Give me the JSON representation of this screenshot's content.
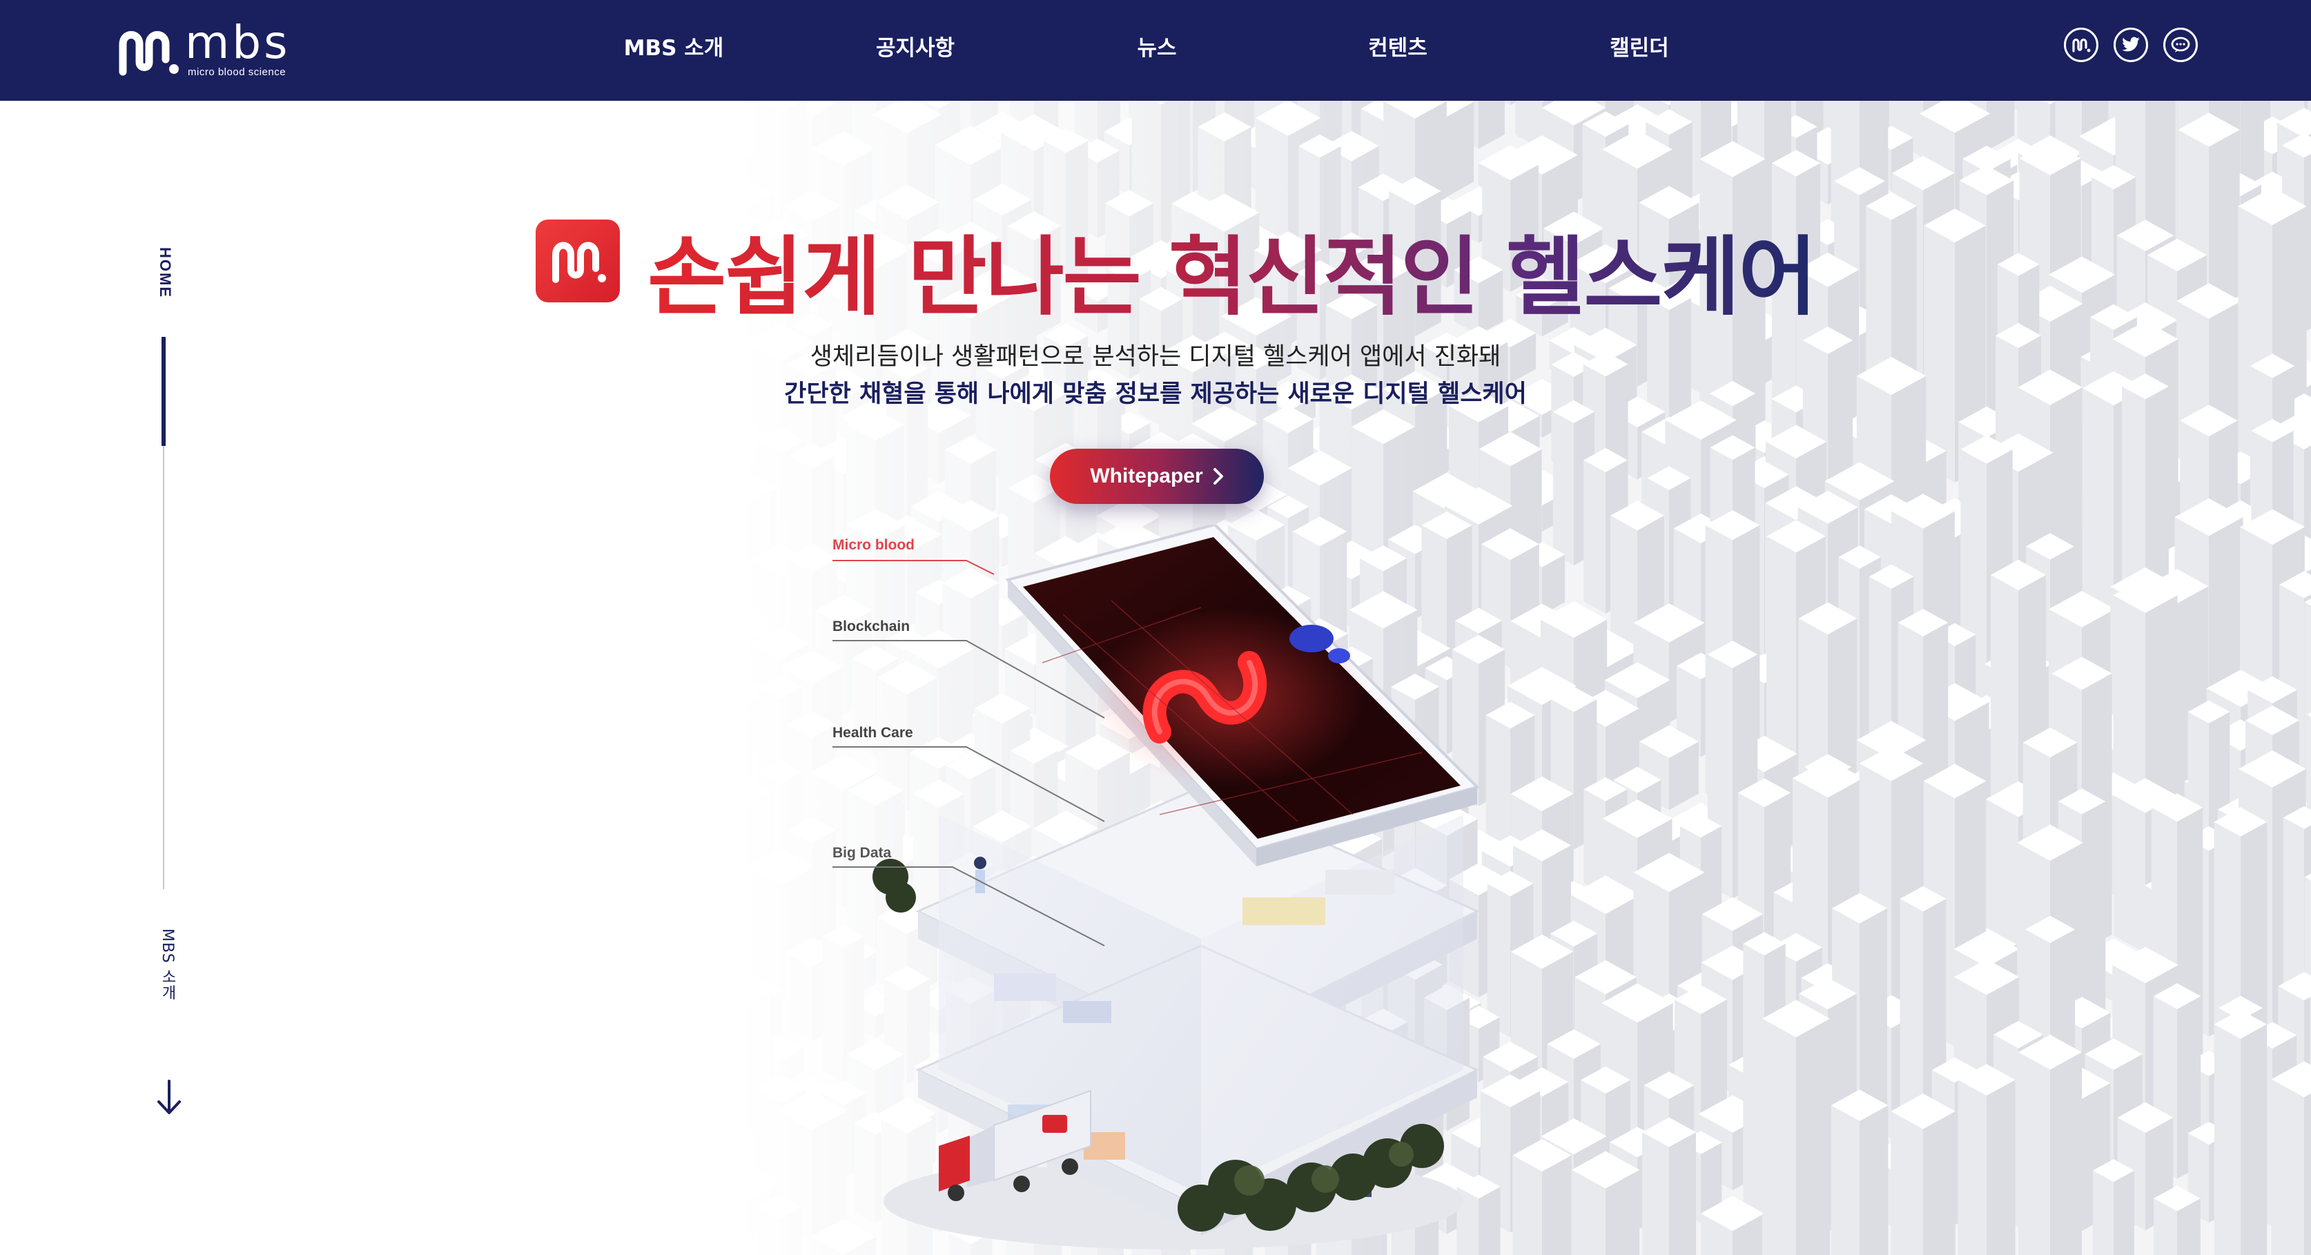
{
  "header": {
    "logo_word": "mbs",
    "logo_sub": "micro blood science",
    "nav": [
      {
        "label": "MBS 소개"
      },
      {
        "label": "공지사항"
      },
      {
        "label": "뉴스"
      },
      {
        "label": "컨텐츠"
      },
      {
        "label": "캘린더"
      }
    ],
    "social": [
      "mbs-icon",
      "twitter-icon",
      "chat-icon"
    ]
  },
  "sidebar": {
    "home_label": "HOME",
    "next_label": "MBS 소개",
    "arrow_icon": "arrow-down-icon"
  },
  "hero": {
    "title": "손쉽게 만나는 혁신적인 헬스케어",
    "line1": "생체리듬이나 생활패턴으로 분석하는 디지털 헬스케어 앱에서 진화돼",
    "line2": "간단한 채혈을 통해 나에게 맞춤 정보를 제공하는 새로운 디지털 헬스케어",
    "cta_label": "Whitepaper",
    "cta_icon": "chevron-right-icon"
  },
  "illustration": {
    "callouts": [
      {
        "label": "Micro blood",
        "color": "#e0454a"
      },
      {
        "label": "Blockchain",
        "color": "#444444"
      },
      {
        "label": "Health Care",
        "color": "#444444"
      },
      {
        "label": "Big Data",
        "color": "#555555"
      }
    ]
  },
  "colors": {
    "navy": "#1a1f5e",
    "red": "#e0262d"
  }
}
